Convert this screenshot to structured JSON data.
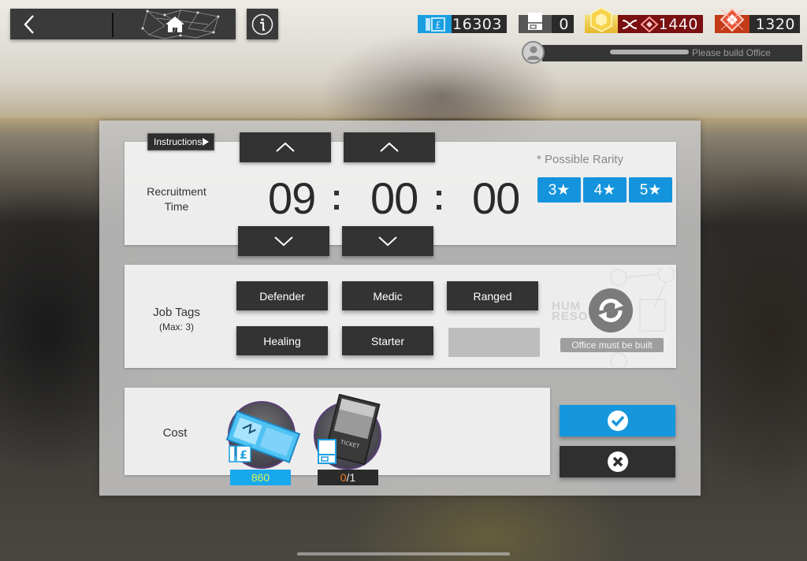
{
  "topbar": {
    "back_icon": "chevron-left-icon",
    "home_icon": "home-icon",
    "info_icon": "info-icon"
  },
  "resources": {
    "lmd": {
      "icon": "lmd-icon",
      "value": "16303",
      "color": "#1a9ee0"
    },
    "recruitment_permit": {
      "icon": "recruitment-permit-icon",
      "value": "0"
    },
    "originite": {
      "icon": "originite-prime-icon",
      "convert_icon": "exchange-icon",
      "value": "1440",
      "color": "#7a1010"
    },
    "orundum": {
      "icon": "orundum-icon",
      "value": "1320",
      "color": "#c23a18"
    }
  },
  "office": {
    "status_text": "Please build Office",
    "progress": 0
  },
  "dialog": {
    "instructions_label": "Instructions",
    "time": {
      "label_line1": "Recruitment",
      "label_line2": "Time",
      "hours": "09",
      "minutes": "00",
      "seconds": "00"
    },
    "rarity": {
      "label": "* Possible Rarity",
      "badges": [
        "3★",
        "4★",
        "5★"
      ],
      "color": "#1494dc"
    },
    "tags": {
      "label_line1": "Job Tags",
      "label_line2": "(Max: 3)",
      "items": [
        "Defender",
        "Medic",
        "Ranged",
        "Healing",
        "Starter"
      ],
      "refresh_watermark": "HUM\nRESO",
      "refresh_note": "Office must be built"
    },
    "cost": {
      "label": "Cost",
      "lmd_amount": "860",
      "permit_have": "0",
      "permit_need": "/1"
    },
    "confirm_icon": "check-circle-icon",
    "cancel_icon": "close-circle-icon"
  }
}
